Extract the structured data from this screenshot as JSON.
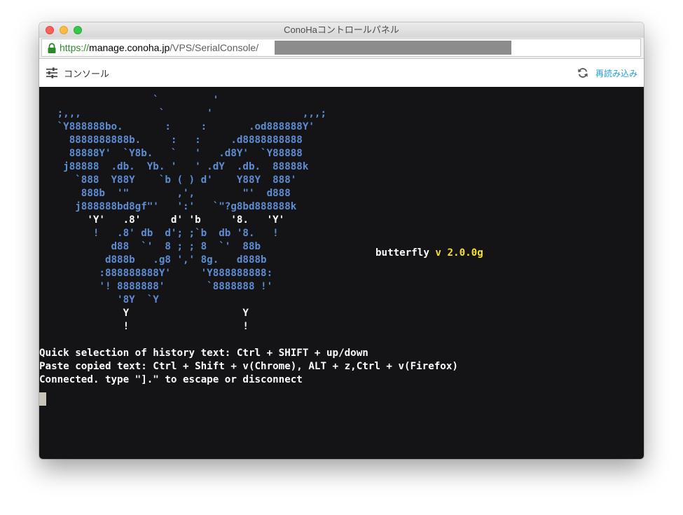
{
  "window": {
    "title": "ConoHaコントロールパネル"
  },
  "address_bar": {
    "scheme": "https://",
    "host": "manage.conoha.jp",
    "path": "/VPS/SerialConsole/"
  },
  "toolbar": {
    "console_label": "コンソール",
    "reload_label": "再読み込み"
  },
  "terminal": {
    "ascii_art": [
      "                   `         '",
      "   ;,,,             `       '               ,,,;",
      "   `Y888888bo.       :     :       .od888888Y'",
      "     8888888888b.     :   :     .d8888888888",
      "     88888Y'  `Y8b.   `   '   .d8Y'  `Y88888",
      "    j88888  .db.  Yb. '   ' .dY  .db.  88888k",
      "      `888  Y88Y    `b ( ) d'    Y88Y  888'",
      "       888b  '\"        ,',        \"'  d888",
      "      j888888bd8gf\"'   ':'   `\"?g8bd888888k",
      "        'Y'   .8'     d' 'b     '8.   'Y'",
      "         !   .8' db  d'; ;`b  db '8.   !",
      "            d88  `'  8 ; ; 8  `'  88b",
      "           d888b   .g8 ',' 8g.   d888b",
      "          :888888888Y'     'Y888888888:",
      "          '! 8888888'       `8888888 !'",
      "             '8Y  `Y",
      "              Y                   Y",
      "              !                   !"
    ],
    "banner_name": "butterfly",
    "banner_version": "v 2.0.0g",
    "lines": [
      "Quick selection of history text: Ctrl + SHIFT + up/down",
      "Paste copied text: Ctrl + Shift + v(Chrome), ALT + z,Ctrl + v(Firefox)",
      "Connected. type \"].\" to escape or disconnect"
    ]
  },
  "colors": {
    "terminal_bg": "#141316",
    "ascii_blue": "#5d8dd3",
    "version_yellow": "#f6e02c",
    "link_blue": "#1f9fd6",
    "url_green": "#2c8a2c"
  }
}
